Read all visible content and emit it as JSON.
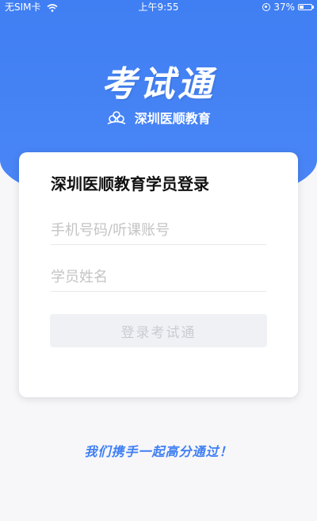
{
  "status_bar": {
    "carrier": "无SIM卡",
    "time": "上午9:55",
    "battery": "37%",
    "battery_level": 0.37
  },
  "brand": {
    "logo_text": "考试通",
    "org_name": "深圳医顺教育"
  },
  "login": {
    "title": "深圳医顺教育学员登录",
    "phone_placeholder": "手机号码/听课账号",
    "name_placeholder": "学员姓名",
    "button_label": "登录考试通"
  },
  "slogan": "我们携手一起高分通过！",
  "colors": {
    "accent": "#3f7ff3",
    "button_disabled_bg": "#f0f1f4",
    "button_disabled_text": "#c9ccd3"
  }
}
